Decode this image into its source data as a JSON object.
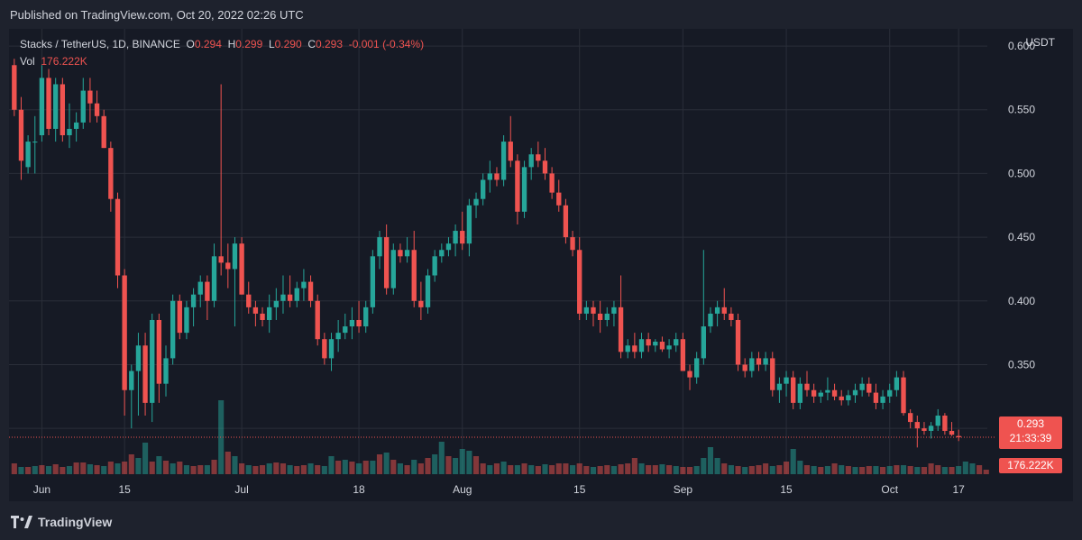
{
  "published": "Published on TradingView.com, Oct 20, 2022 02:26 UTC",
  "header": {
    "symbol": "Stacks / TetherUS, 1D, BINANCE",
    "o_label": "O",
    "o_value": "0.294",
    "h_label": "H",
    "h_value": "0.299",
    "l_label": "L",
    "l_value": "0.290",
    "c_label": "C",
    "c_value": "0.293",
    "change": "-0.001 (-0.34%)"
  },
  "volume": {
    "label": "Vol",
    "value": "176.222K"
  },
  "unit": "USDT",
  "price_badge": {
    "price": "0.293",
    "countdown": "21:33:39"
  },
  "volume_badge": "176.222K",
  "logo": "TradingView",
  "colors": {
    "up": "#26a69a",
    "down": "#ef5350",
    "grid": "#2a2e39",
    "background": "#161a25",
    "text": "#d1d4dc"
  },
  "chart_data": {
    "type": "candlestick",
    "y_ticks": [
      "0.600",
      "0.550",
      "0.500",
      "0.450",
      "0.400",
      "0.350",
      "0.300"
    ],
    "ylim": [
      0.28,
      0.605
    ],
    "x_ticks": [
      "Jun",
      "15",
      "Jul",
      "18",
      "Aug",
      "15",
      "Sep",
      "15",
      "Oct",
      "17"
    ],
    "last_price": 0.293,
    "candles": [
      [
        0.585,
        0.59,
        0.545,
        0.55
      ],
      [
        0.55,
        0.56,
        0.495,
        0.51
      ],
      [
        0.505,
        0.53,
        0.5,
        0.525
      ],
      [
        0.525,
        0.545,
        0.5,
        0.525
      ],
      [
        0.53,
        0.585,
        0.525,
        0.575
      ],
      [
        0.575,
        0.582,
        0.53,
        0.535
      ],
      [
        0.535,
        0.575,
        0.525,
        0.57
      ],
      [
        0.57,
        0.575,
        0.525,
        0.53
      ],
      [
        0.53,
        0.555,
        0.52,
        0.535
      ],
      [
        0.535,
        0.548,
        0.525,
        0.54
      ],
      [
        0.54,
        0.575,
        0.535,
        0.565
      ],
      [
        0.565,
        0.575,
        0.54,
        0.555
      ],
      [
        0.555,
        0.565,
        0.54,
        0.545
      ],
      [
        0.545,
        0.55,
        0.52,
        0.52
      ],
      [
        0.52,
        0.525,
        0.47,
        0.48
      ],
      [
        0.48,
        0.485,
        0.41,
        0.42
      ],
      [
        0.42,
        0.425,
        0.31,
        0.33
      ],
      [
        0.33,
        0.35,
        0.3,
        0.345
      ],
      [
        0.345,
        0.375,
        0.31,
        0.365
      ],
      [
        0.365,
        0.375,
        0.31,
        0.32
      ],
      [
        0.32,
        0.39,
        0.305,
        0.385
      ],
      [
        0.385,
        0.39,
        0.32,
        0.335
      ],
      [
        0.335,
        0.365,
        0.325,
        0.355
      ],
      [
        0.355,
        0.405,
        0.35,
        0.4
      ],
      [
        0.4,
        0.405,
        0.37,
        0.375
      ],
      [
        0.375,
        0.4,
        0.37,
        0.395
      ],
      [
        0.395,
        0.41,
        0.38,
        0.405
      ],
      [
        0.405,
        0.42,
        0.395,
        0.415
      ],
      [
        0.415,
        0.42,
        0.385,
        0.4
      ],
      [
        0.4,
        0.445,
        0.395,
        0.435
      ],
      [
        0.435,
        0.57,
        0.42,
        0.43
      ],
      [
        0.43,
        0.445,
        0.41,
        0.425
      ],
      [
        0.425,
        0.45,
        0.38,
        0.445
      ],
      [
        0.445,
        0.45,
        0.405,
        0.405
      ],
      [
        0.405,
        0.415,
        0.39,
        0.395
      ],
      [
        0.395,
        0.4,
        0.38,
        0.39
      ],
      [
        0.39,
        0.395,
        0.38,
        0.385
      ],
      [
        0.385,
        0.405,
        0.375,
        0.395
      ],
      [
        0.395,
        0.41,
        0.385,
        0.4
      ],
      [
        0.4,
        0.42,
        0.39,
        0.405
      ],
      [
        0.405,
        0.42,
        0.395,
        0.4
      ],
      [
        0.4,
        0.415,
        0.395,
        0.41
      ],
      [
        0.41,
        0.425,
        0.4,
        0.415
      ],
      [
        0.415,
        0.42,
        0.395,
        0.4
      ],
      [
        0.4,
        0.405,
        0.365,
        0.37
      ],
      [
        0.37,
        0.375,
        0.35,
        0.355
      ],
      [
        0.355,
        0.375,
        0.345,
        0.37
      ],
      [
        0.37,
        0.385,
        0.36,
        0.375
      ],
      [
        0.375,
        0.39,
        0.37,
        0.38
      ],
      [
        0.38,
        0.395,
        0.37,
        0.385
      ],
      [
        0.385,
        0.4,
        0.375,
        0.38
      ],
      [
        0.38,
        0.4,
        0.375,
        0.395
      ],
      [
        0.395,
        0.44,
        0.39,
        0.435
      ],
      [
        0.435,
        0.455,
        0.425,
        0.45
      ],
      [
        0.45,
        0.46,
        0.405,
        0.41
      ],
      [
        0.41,
        0.445,
        0.405,
        0.44
      ],
      [
        0.44,
        0.445,
        0.43,
        0.435
      ],
      [
        0.435,
        0.45,
        0.43,
        0.44
      ],
      [
        0.44,
        0.455,
        0.395,
        0.4
      ],
      [
        0.4,
        0.415,
        0.385,
        0.395
      ],
      [
        0.395,
        0.425,
        0.39,
        0.42
      ],
      [
        0.42,
        0.44,
        0.415,
        0.435
      ],
      [
        0.435,
        0.445,
        0.43,
        0.44
      ],
      [
        0.44,
        0.45,
        0.435,
        0.445
      ],
      [
        0.445,
        0.46,
        0.435,
        0.455
      ],
      [
        0.455,
        0.47,
        0.44,
        0.445
      ],
      [
        0.445,
        0.48,
        0.435,
        0.475
      ],
      [
        0.475,
        0.485,
        0.465,
        0.48
      ],
      [
        0.48,
        0.5,
        0.475,
        0.495
      ],
      [
        0.495,
        0.51,
        0.485,
        0.5
      ],
      [
        0.5,
        0.505,
        0.49,
        0.495
      ],
      [
        0.495,
        0.53,
        0.49,
        0.525
      ],
      [
        0.525,
        0.545,
        0.505,
        0.51
      ],
      [
        0.51,
        0.515,
        0.46,
        0.47
      ],
      [
        0.47,
        0.51,
        0.465,
        0.505
      ],
      [
        0.505,
        0.52,
        0.495,
        0.515
      ],
      [
        0.515,
        0.525,
        0.505,
        0.51
      ],
      [
        0.51,
        0.52,
        0.495,
        0.5
      ],
      [
        0.5,
        0.505,
        0.48,
        0.485
      ],
      [
        0.485,
        0.495,
        0.47,
        0.475
      ],
      [
        0.475,
        0.48,
        0.445,
        0.45
      ],
      [
        0.45,
        0.455,
        0.435,
        0.44
      ],
      [
        0.44,
        0.45,
        0.385,
        0.39
      ],
      [
        0.39,
        0.4,
        0.385,
        0.395
      ],
      [
        0.395,
        0.4,
        0.38,
        0.39
      ],
      [
        0.39,
        0.4,
        0.375,
        0.385
      ],
      [
        0.385,
        0.395,
        0.38,
        0.39
      ],
      [
        0.39,
        0.4,
        0.38,
        0.395
      ],
      [
        0.395,
        0.42,
        0.355,
        0.36
      ],
      [
        0.36,
        0.37,
        0.355,
        0.365
      ],
      [
        0.365,
        0.375,
        0.355,
        0.36
      ],
      [
        0.36,
        0.375,
        0.355,
        0.37
      ],
      [
        0.37,
        0.375,
        0.36,
        0.365
      ],
      [
        0.365,
        0.37,
        0.36,
        0.368
      ],
      [
        0.368,
        0.372,
        0.36,
        0.362
      ],
      [
        0.362,
        0.37,
        0.355,
        0.365
      ],
      [
        0.365,
        0.375,
        0.36,
        0.37
      ],
      [
        0.37,
        0.375,
        0.355,
        0.345
      ],
      [
        0.345,
        0.35,
        0.33,
        0.34
      ],
      [
        0.34,
        0.36,
        0.335,
        0.355
      ],
      [
        0.355,
        0.44,
        0.35,
        0.38
      ],
      [
        0.38,
        0.395,
        0.375,
        0.39
      ],
      [
        0.39,
        0.4,
        0.38,
        0.395
      ],
      [
        0.395,
        0.41,
        0.385,
        0.39
      ],
      [
        0.39,
        0.395,
        0.38,
        0.385
      ],
      [
        0.385,
        0.39,
        0.345,
        0.35
      ],
      [
        0.35,
        0.355,
        0.34,
        0.345
      ],
      [
        0.345,
        0.36,
        0.34,
        0.355
      ],
      [
        0.355,
        0.36,
        0.345,
        0.35
      ],
      [
        0.35,
        0.36,
        0.345,
        0.355
      ],
      [
        0.355,
        0.36,
        0.325,
        0.33
      ],
      [
        0.33,
        0.34,
        0.32,
        0.335
      ],
      [
        0.335,
        0.345,
        0.325,
        0.34
      ],
      [
        0.34,
        0.345,
        0.315,
        0.32
      ],
      [
        0.32,
        0.34,
        0.315,
        0.335
      ],
      [
        0.335,
        0.345,
        0.325,
        0.33
      ],
      [
        0.33,
        0.335,
        0.32,
        0.325
      ],
      [
        0.325,
        0.33,
        0.32,
        0.328
      ],
      [
        0.328,
        0.34,
        0.322,
        0.33
      ],
      [
        0.33,
        0.335,
        0.322,
        0.325
      ],
      [
        0.325,
        0.33,
        0.318,
        0.322
      ],
      [
        0.322,
        0.33,
        0.318,
        0.326
      ],
      [
        0.326,
        0.335,
        0.32,
        0.33
      ],
      [
        0.33,
        0.34,
        0.325,
        0.335
      ],
      [
        0.335,
        0.34,
        0.325,
        0.328
      ],
      [
        0.328,
        0.335,
        0.315,
        0.32
      ],
      [
        0.32,
        0.33,
        0.315,
        0.325
      ],
      [
        0.325,
        0.335,
        0.32,
        0.33
      ],
      [
        0.33,
        0.345,
        0.325,
        0.34
      ],
      [
        0.34,
        0.345,
        0.31,
        0.312
      ],
      [
        0.312,
        0.315,
        0.3,
        0.305
      ],
      [
        0.305,
        0.31,
        0.285,
        0.3
      ],
      [
        0.3,
        0.305,
        0.295,
        0.298
      ],
      [
        0.298,
        0.305,
        0.292,
        0.302
      ],
      [
        0.302,
        0.315,
        0.298,
        0.31
      ],
      [
        0.31,
        0.312,
        0.295,
        0.298
      ],
      [
        0.298,
        0.305,
        0.294,
        0.295
      ],
      [
        0.294,
        0.299,
        0.29,
        0.293
      ]
    ],
    "volumes": [
      [
        12,
        0
      ],
      [
        8,
        1
      ],
      [
        8,
        0
      ],
      [
        9,
        1
      ],
      [
        10,
        0
      ],
      [
        9,
        1
      ],
      [
        11,
        0
      ],
      [
        8,
        0
      ],
      [
        9,
        1
      ],
      [
        13,
        0
      ],
      [
        13,
        0
      ],
      [
        11,
        1
      ],
      [
        10,
        0
      ],
      [
        9,
        1
      ],
      [
        14,
        0
      ],
      [
        12,
        1
      ],
      [
        14,
        0
      ],
      [
        22,
        0
      ],
      [
        18,
        1
      ],
      [
        35,
        1
      ],
      [
        14,
        0
      ],
      [
        20,
        1
      ],
      [
        15,
        0
      ],
      [
        12,
        1
      ],
      [
        14,
        0
      ],
      [
        10,
        1
      ],
      [
        9,
        0
      ],
      [
        10,
        0
      ],
      [
        10,
        1
      ],
      [
        16,
        0
      ],
      [
        82,
        1
      ],
      [
        25,
        0
      ],
      [
        20,
        1
      ],
      [
        12,
        0
      ],
      [
        10,
        1
      ],
      [
        9,
        0
      ],
      [
        10,
        0
      ],
      [
        12,
        1
      ],
      [
        13,
        0
      ],
      [
        12,
        0
      ],
      [
        10,
        1
      ],
      [
        9,
        0
      ],
      [
        10,
        0
      ],
      [
        12,
        1
      ],
      [
        10,
        0
      ],
      [
        9,
        1
      ],
      [
        20,
        1
      ],
      [
        15,
        0
      ],
      [
        16,
        1
      ],
      [
        14,
        0
      ],
      [
        12,
        1
      ],
      [
        15,
        0
      ],
      [
        15,
        1
      ],
      [
        22,
        0
      ],
      [
        24,
        1
      ],
      [
        16,
        0
      ],
      [
        12,
        1
      ],
      [
        10,
        0
      ],
      [
        16,
        1
      ],
      [
        12,
        0
      ],
      [
        18,
        0
      ],
      [
        22,
        1
      ],
      [
        36,
        1
      ],
      [
        20,
        0
      ],
      [
        18,
        1
      ],
      [
        28,
        1
      ],
      [
        26,
        1
      ],
      [
        20,
        0
      ],
      [
        12,
        0
      ],
      [
        10,
        1
      ],
      [
        12,
        0
      ],
      [
        14,
        1
      ],
      [
        10,
        0
      ],
      [
        10,
        1
      ],
      [
        12,
        0
      ],
      [
        10,
        1
      ],
      [
        9,
        0
      ],
      [
        11,
        1
      ],
      [
        10,
        0
      ],
      [
        12,
        0
      ],
      [
        12,
        0
      ],
      [
        10,
        1
      ],
      [
        12,
        0
      ],
      [
        9,
        0
      ],
      [
        8,
        1
      ],
      [
        9,
        0
      ],
      [
        10,
        0
      ],
      [
        9,
        1
      ],
      [
        11,
        0
      ],
      [
        12,
        0
      ],
      [
        18,
        0
      ],
      [
        12,
        1
      ],
      [
        10,
        0
      ],
      [
        10,
        0
      ],
      [
        11,
        1
      ],
      [
        10,
        0
      ],
      [
        9,
        1
      ],
      [
        8,
        0
      ],
      [
        8,
        0
      ],
      [
        9,
        1
      ],
      [
        18,
        1
      ],
      [
        30,
        1
      ],
      [
        18,
        1
      ],
      [
        12,
        0
      ],
      [
        10,
        1
      ],
      [
        9,
        0
      ],
      [
        8,
        1
      ],
      [
        9,
        0
      ],
      [
        10,
        0
      ],
      [
        12,
        0
      ],
      [
        9,
        1
      ],
      [
        10,
        0
      ],
      [
        14,
        0
      ],
      [
        28,
        1
      ],
      [
        15,
        1
      ],
      [
        10,
        0
      ],
      [
        9,
        1
      ],
      [
        8,
        0
      ],
      [
        9,
        1
      ],
      [
        12,
        0
      ],
      [
        10,
        1
      ],
      [
        9,
        0
      ],
      [
        8,
        1
      ],
      [
        8,
        0
      ],
      [
        9,
        0
      ],
      [
        9,
        1
      ],
      [
        8,
        0
      ],
      [
        9,
        1
      ],
      [
        10,
        0
      ],
      [
        10,
        1
      ],
      [
        9,
        0
      ],
      [
        8,
        1
      ],
      [
        8,
        0
      ],
      [
        12,
        0
      ],
      [
        10,
        0
      ],
      [
        8,
        1
      ],
      [
        8,
        0
      ],
      [
        9,
        1
      ],
      [
        14,
        1
      ],
      [
        12,
        1
      ],
      [
        10,
        0
      ],
      [
        5,
        0
      ]
    ]
  }
}
